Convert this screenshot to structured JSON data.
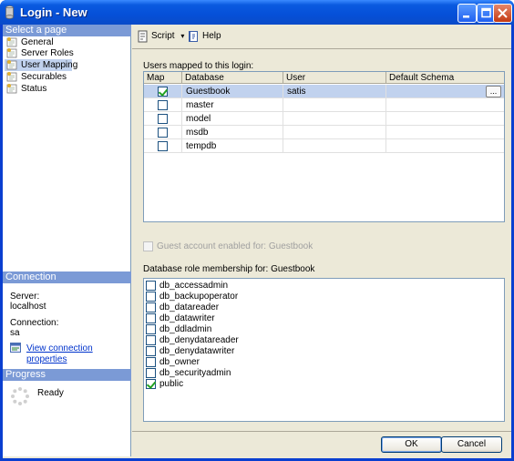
{
  "window": {
    "title": "Login - New"
  },
  "left": {
    "select_page_header": "Select a page",
    "pages": [
      "General",
      "Server Roles",
      "User Mapping",
      "Securables",
      "Status"
    ],
    "selected_page_index": 2,
    "connection_header": "Connection",
    "server_label": "Server:",
    "server_value": "localhost",
    "connection_label": "Connection:",
    "connection_value": "sa",
    "view_connection_link": "View connection properties",
    "progress_header": "Progress",
    "progress_status": "Ready"
  },
  "toolbar": {
    "script_label": "Script",
    "help_label": "Help"
  },
  "mapping": {
    "group_label": "Users mapped to this login:",
    "columns": [
      "Map",
      "Database",
      "User",
      "Default Schema"
    ],
    "rows": [
      {
        "map": true,
        "database": "Guestbook",
        "user": "satis",
        "schema": ""
      },
      {
        "map": false,
        "database": "master",
        "user": "",
        "schema": ""
      },
      {
        "map": false,
        "database": "model",
        "user": "",
        "schema": ""
      },
      {
        "map": false,
        "database": "msdb",
        "user": "",
        "schema": ""
      },
      {
        "map": false,
        "database": "tempdb",
        "user": "",
        "schema": ""
      }
    ],
    "ellipsis_label": "..."
  },
  "guest": {
    "label": "Guest account enabled for: Guestbook",
    "checked": false,
    "enabled": false
  },
  "roles": {
    "group_label": "Database role membership for: Guestbook",
    "items": [
      {
        "name": "db_accessadmin",
        "checked": false
      },
      {
        "name": "db_backupoperator",
        "checked": false
      },
      {
        "name": "db_datareader",
        "checked": false
      },
      {
        "name": "db_datawriter",
        "checked": false
      },
      {
        "name": "db_ddladmin",
        "checked": false
      },
      {
        "name": "db_denydatareader",
        "checked": false
      },
      {
        "name": "db_denydatawriter",
        "checked": false
      },
      {
        "name": "db_owner",
        "checked": false
      },
      {
        "name": "db_securityadmin",
        "checked": false
      },
      {
        "name": "public",
        "checked": true
      }
    ]
  },
  "buttons": {
    "ok": "OK",
    "cancel": "Cancel"
  },
  "colors": {
    "titlebar": "#0550d8",
    "section_header": "#7b9ad6",
    "selection": "#c1d2ee",
    "dialog_bg": "#ece9d8"
  }
}
